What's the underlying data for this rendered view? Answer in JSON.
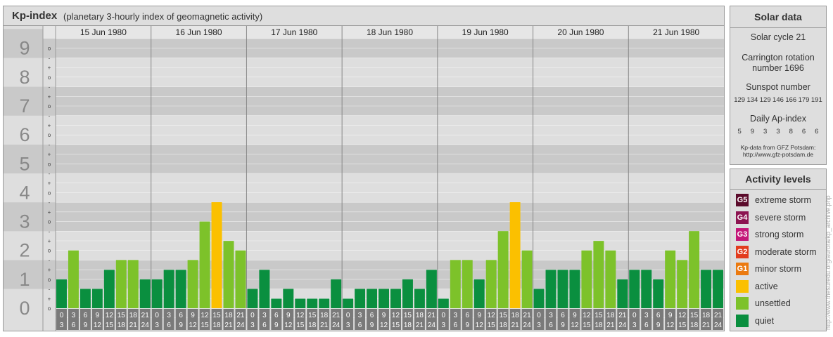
{
  "header": {
    "title": "Kp-index",
    "subtitle": "(planetary 3-hourly index of geomagnetic activity)"
  },
  "solar_data": {
    "title": "Solar data",
    "cycle": "Solar cycle 21",
    "carrington_line1": "Carrington rotation",
    "carrington_line2": "number 1696",
    "sunspot_title": "Sunspot number",
    "sunspot_values": [
      "129",
      "134",
      "129",
      "146",
      "166",
      "179",
      "191"
    ],
    "ap_title": "Daily Ap-index",
    "ap_values": [
      "5",
      "9",
      "3",
      "3",
      "8",
      "6",
      "6"
    ],
    "source_line1": "Kp-data from GFZ Potsdam:",
    "source_line2": "http://www.gfz-potsdam.de"
  },
  "activity_levels": {
    "title": "Activity levels",
    "items": [
      {
        "code": "G5",
        "label": "extreme storm",
        "color": "#5b0b2b"
      },
      {
        "code": "G4",
        "label": "severe storm",
        "color": "#8c1450"
      },
      {
        "code": "G3",
        "label": "strong storm",
        "color": "#c41678"
      },
      {
        "code": "G2",
        "label": "moderate storm",
        "color": "#e23c1e"
      },
      {
        "code": "G1",
        "label": "minor storm",
        "color": "#eb7a10"
      },
      {
        "code": "",
        "label": "active",
        "color": "#fbc000"
      },
      {
        "code": "",
        "label": "unsettled",
        "color": "#7dc22a"
      },
      {
        "code": "",
        "label": "quiet",
        "color": "#0a8f3f"
      }
    ]
  },
  "watermark": "http://www.thesuredu.org/aurora/kp_archive.php",
  "chart_data": {
    "type": "bar",
    "title": "Kp-index",
    "ylim": [
      0,
      9
    ],
    "y_ticks": [
      "0",
      "1",
      "2",
      "3",
      "4",
      "5",
      "6",
      "7",
      "8",
      "9"
    ],
    "sub_ticks": [
      "o",
      "+",
      "-"
    ],
    "days": [
      "15 Jun 1980",
      "16 Jun 1980",
      "17 Jun 1980",
      "18 Jun 1980",
      "19 Jun 1980",
      "20 Jun 1980",
      "21 Jun 1980"
    ],
    "hour_start": [
      "0",
      "3",
      "6",
      "9",
      "12",
      "15",
      "18",
      "21"
    ],
    "hour_end": [
      "3",
      "6",
      "9",
      "12",
      "15",
      "18",
      "21",
      "24"
    ],
    "values": [
      1.0,
      2.0,
      0.67,
      0.67,
      1.33,
      1.67,
      1.67,
      1.0,
      1.0,
      1.33,
      1.33,
      1.67,
      3.0,
      3.67,
      2.33,
      2.0,
      0.67,
      1.33,
      0.33,
      0.67,
      0.33,
      0.33,
      0.33,
      1.0,
      0.33,
      0.67,
      0.67,
      0.67,
      0.67,
      1.0,
      0.67,
      1.33,
      0.33,
      1.67,
      1.67,
      1.0,
      1.67,
      2.67,
      3.67,
      2.0,
      0.67,
      1.33,
      1.33,
      1.33,
      2.0,
      2.33,
      2.0,
      1.0,
      1.33,
      1.33,
      1.0,
      2.0,
      1.67,
      2.67,
      1.33,
      1.33
    ],
    "levels": [
      "quiet",
      "unsettled",
      "quiet",
      "quiet",
      "quiet",
      "unsettled",
      "unsettled",
      "quiet",
      "quiet",
      "quiet",
      "quiet",
      "unsettled",
      "unsettled",
      "active",
      "unsettled",
      "unsettled",
      "quiet",
      "quiet",
      "quiet",
      "quiet",
      "quiet",
      "quiet",
      "quiet",
      "quiet",
      "quiet",
      "quiet",
      "quiet",
      "quiet",
      "quiet",
      "quiet",
      "quiet",
      "quiet",
      "quiet",
      "unsettled",
      "unsettled",
      "quiet",
      "unsettled",
      "unsettled",
      "active",
      "unsettled",
      "quiet",
      "quiet",
      "quiet",
      "quiet",
      "unsettled",
      "unsettled",
      "unsettled",
      "quiet",
      "quiet",
      "quiet",
      "quiet",
      "unsettled",
      "unsettled",
      "unsettled",
      "quiet",
      "quiet"
    ],
    "colors": {
      "quiet": "#0a8f3f",
      "unsettled": "#7dc22a",
      "active": "#fbc000",
      "band_dark": "#c9c9c9",
      "band_light": "#dedede",
      "axis_label": "#888888",
      "hour_box": "#7a7a7a"
    }
  }
}
